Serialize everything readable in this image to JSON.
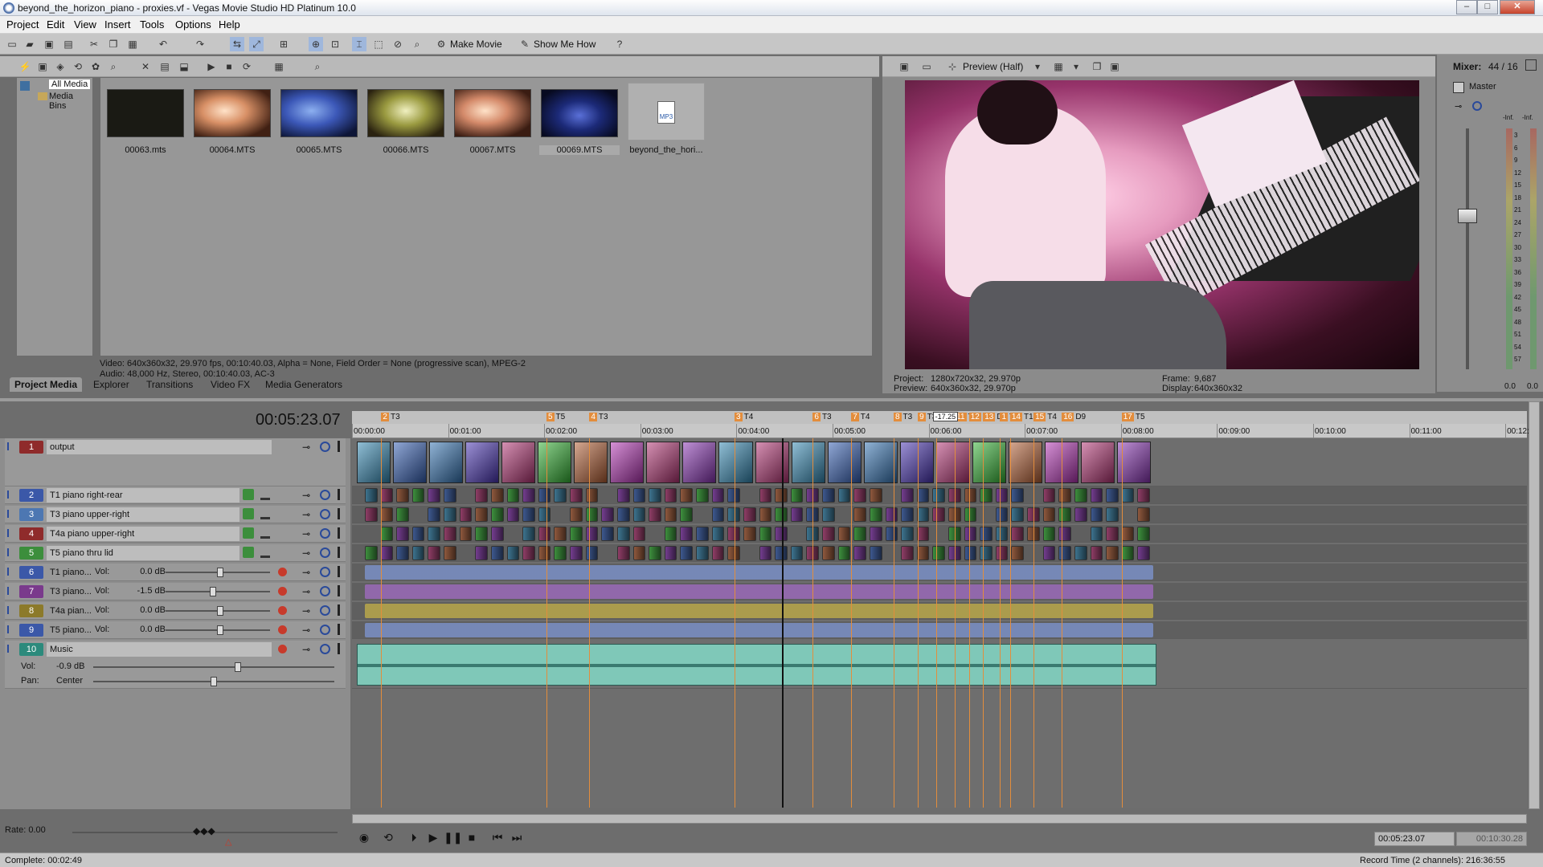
{
  "window": {
    "title": "beyond_the_horizon_piano - proxies.vf - Vegas Movie Studio HD Platinum 10.0",
    "min": "–",
    "max": "□",
    "close": "✕"
  },
  "menu": [
    "Project",
    "Edit",
    "View",
    "Insert",
    "Tools",
    "Options",
    "Help"
  ],
  "toolbar": {
    "make_movie": "Make Movie",
    "show_me_how": "Show Me How"
  },
  "media": {
    "tree": [
      "All Media",
      "Media Bins"
    ],
    "files": [
      "00063.mts",
      "00064.MTS",
      "00065.MTS",
      "00066.MTS",
      "00067.MTS",
      "00069.MTS",
      "beyond_the_hori..."
    ],
    "selected_index": 5,
    "mp3_badge": "MP3",
    "info_video": "Video: 640x360x32, 29.970 fps, 00:10:40.03, Alpha = None, Field Order = None (progressive scan), MPEG-2",
    "info_audio": "Audio: 48,000 Hz, Stereo, 00:10:40.03, AC-3",
    "tabs": [
      "Project Media",
      "Explorer",
      "Transitions",
      "Video FX",
      "Media Generators"
    ]
  },
  "preview": {
    "mode": "Preview (Half)",
    "project_label": "Project:",
    "project_value": "1280x720x32, 29.970p",
    "preview_label": "Preview:",
    "preview_value": "640x360x32, 29.970p",
    "frame_label": "Frame:",
    "frame_value": "9,687",
    "display_label": "Display:",
    "display_value": "640x360x32"
  },
  "mixer": {
    "title": "Mixer:",
    "count": "44 / 16",
    "master": "Master",
    "inf_l": "-Inf.",
    "inf_r": "-Inf.",
    "scale": [
      "3",
      "6",
      "9",
      "12",
      "15",
      "18",
      "21",
      "24",
      "27",
      "30",
      "33",
      "36",
      "39",
      "42",
      "45",
      "48",
      "51",
      "54",
      "57"
    ],
    "out_l": "0.0",
    "out_r": "0.0"
  },
  "timeline": {
    "timecode": "00:05:23.07",
    "ruler": [
      "00:00:00",
      "00:01:00",
      "00:02:00",
      "00:03:00",
      "00:04:00",
      "00:05:00",
      "00:06:00",
      "00:07:00",
      "00:08:00",
      "00:09:00",
      "00:10:00",
      "00:11:00",
      "00:12:"
    ],
    "ruler_fraction": [
      0,
      0.0818,
      0.1636,
      0.2454,
      0.3272,
      0.409,
      0.4908,
      0.5726,
      0.6544,
      0.7362,
      0.818,
      0.8998,
      0.9816
    ],
    "cursor_fraction": 0.3616,
    "cursor_badge": "-17.25",
    "markers": [
      {
        "num": "2",
        "label": "T3",
        "at": 0.0208
      },
      {
        "num": "5",
        "label": "T5",
        "at": 0.1614
      },
      {
        "num": "4",
        "label": "T3",
        "at": 0.1979
      },
      {
        "num": "3",
        "label": "T4",
        "at": 0.3215
      },
      {
        "num": "6",
        "label": "T3",
        "at": 0.3881
      },
      {
        "num": "7",
        "label": "T4",
        "at": 0.4208
      },
      {
        "num": "8",
        "label": "T3",
        "at": 0.4569
      },
      {
        "num": "9",
        "label": "T3",
        "at": 0.4775
      },
      {
        "num": "10",
        "label": "T4",
        "at": 0.4933
      },
      {
        "num": "11",
        "label": "T3",
        "at": 0.509
      },
      {
        "num": "12",
        "label": "T3",
        "at": 0.521
      },
      {
        "num": "13",
        "label": "D9",
        "at": 0.533
      },
      {
        "num": "1",
        "label": "T1",
        "at": 0.5475
      },
      {
        "num": "14",
        "label": "T1",
        "at": 0.556
      },
      {
        "num": "15",
        "label": "T4",
        "at": 0.576
      },
      {
        "num": "16",
        "label": "D9",
        "at": 0.6
      },
      {
        "num": "17",
        "label": "T5",
        "at": 0.651
      }
    ],
    "tracks": [
      {
        "num": "1",
        "name": "output",
        "kind": "video-main",
        "color": "#8f2b2b"
      },
      {
        "num": "2",
        "name": "T1 piano right-rear",
        "kind": "video",
        "color": "#3b58a8"
      },
      {
        "num": "3",
        "name": "T3 piano upper-right",
        "kind": "video",
        "color": "#4d77b2"
      },
      {
        "num": "4",
        "name": "T4a piano upper-right",
        "kind": "video",
        "color": "#8f2b2b"
      },
      {
        "num": "5",
        "name": "T5 piano thru lid",
        "kind": "video",
        "color": "#3c8e3c"
      },
      {
        "num": "6",
        "name": "T1 piano...",
        "kind": "audio",
        "vol": "0.0 dB",
        "level": 0.52,
        "color": "#3b58a8"
      },
      {
        "num": "7",
        "name": "T3 piano...",
        "kind": "audio",
        "vol": "-1.5 dB",
        "level": 0.45,
        "color": "#7a3a8c"
      },
      {
        "num": "8",
        "name": "T4a pian...",
        "kind": "audio",
        "vol": "0.0 dB",
        "level": 0.52,
        "color": "#8c7a2a"
      },
      {
        "num": "9",
        "name": "T5 piano...",
        "kind": "audio",
        "vol": "0.0 dB",
        "level": 0.52,
        "color": "#3b58a8"
      },
      {
        "num": "10",
        "name": "Music",
        "kind": "music",
        "color": "#2c8a7c"
      }
    ],
    "music": {
      "vol_label": "Vol:",
      "vol_value": "-0.9 dB",
      "pan_label": "Pan:",
      "pan_value": "Center"
    },
    "vol_label": "Vol:"
  },
  "footer": {
    "rate": "Rate: 0.00",
    "complete": "Complete: 00:02:49",
    "tc_current": "00:05:23.07",
    "tc_end": "00:10:30.28",
    "record_time": "Record Time (2 channels): 216:36:55"
  },
  "colors": {
    "marker": "#e38d3c",
    "music_wave": "#7fc8b8",
    "audio_wave_blue": "#7a8fc6",
    "audio_wave_purple": "#9a6ab8",
    "audio_wave_yellow": "#b8a74a"
  }
}
